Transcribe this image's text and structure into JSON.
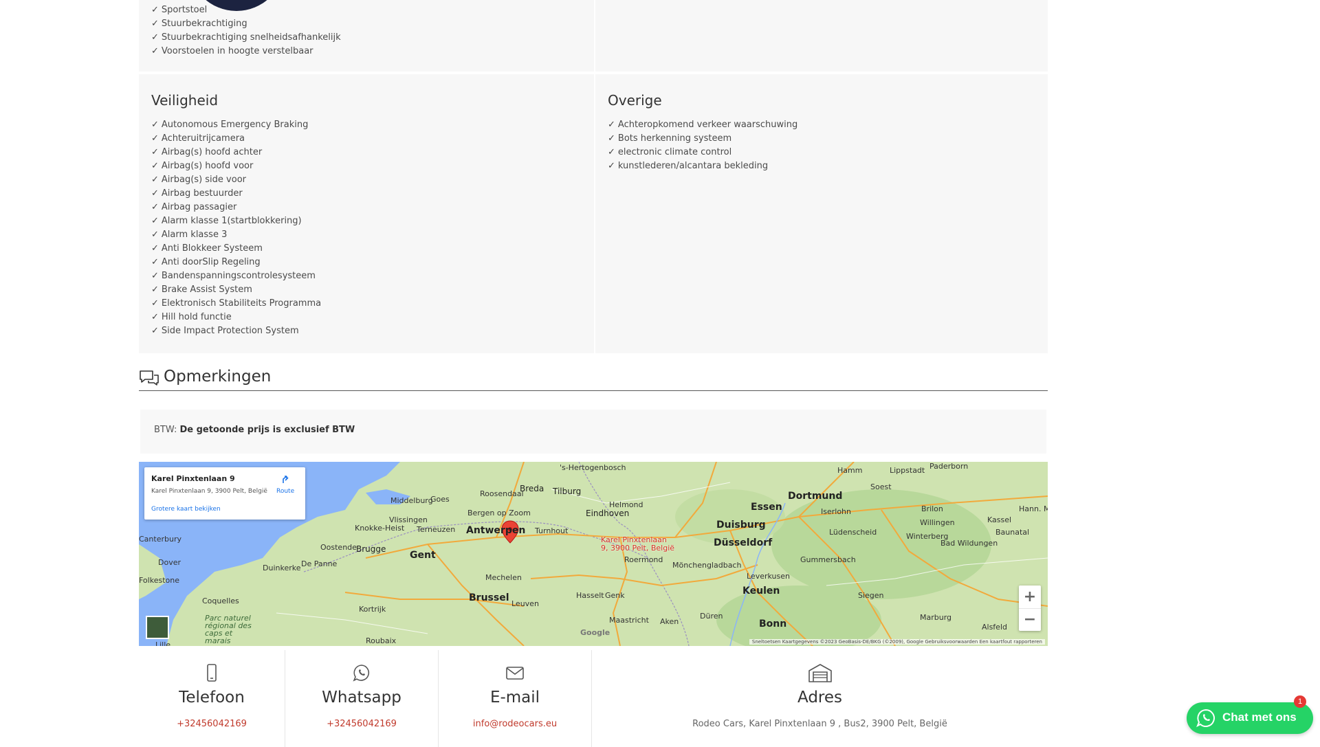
{
  "comfort": {
    "items": [
      "Sportstoel",
      "Stuurbekrachtiging",
      "Stuurbekrachtiging snelheidsafhankelijk",
      "Voorstoelen in hoogte verstelbaar"
    ]
  },
  "check_glyph": "✓",
  "veiligheid": {
    "title": "Veiligheid",
    "items": [
      "Autonomous Emergency Braking",
      "Achteruitrijcamera",
      "Airbag(s) hoofd achter",
      "Airbag(s) hoofd voor",
      "Airbag(s) side voor",
      "Airbag bestuurder",
      "Airbag passagier",
      "Alarm klasse 1(startblokkering)",
      "Alarm klasse 3",
      "Anti Blokkeer Systeem",
      "Anti doorSlip Regeling",
      "Bandenspanningscontrolesysteem",
      "Brake Assist System",
      "Elektronisch Stabiliteits Programma",
      "Hill hold functie",
      "Side Impact Protection System"
    ]
  },
  "overige": {
    "title": "Overige",
    "items": [
      "Achteropkomend verkeer waarschuwing",
      "Bots herkenning systeem",
      "electronic climate control",
      "kunstlederen/alcantara bekleding"
    ]
  },
  "remarks": {
    "heading": "Opmerkingen",
    "btw_label": "BTW:",
    "btw_value": "De getoonde prijs is exclusief BTW"
  },
  "map": {
    "card_title": "Karel Pinxtenlaan 9",
    "card_address": "Karel Pinxtenlaan 9, 3900 Pelt, België",
    "card_link": "Grotere kaart bekijken",
    "route_label": "Route",
    "pin_label_line1": "Karel Pinxtenlaan",
    "pin_label_line2": "9, 3900 Pelt, België",
    "zoom_in": "+",
    "zoom_out": "−",
    "watermark": "Google",
    "footer": "Sneltoetsen   Kaartgegevens ©2023 GeoBasis-DE/BKG (©2009), Google   Gebruiksvoorwaarden   Een kaartfout rapporteren",
    "places_big": [
      "Antwerpen",
      "Brussel",
      "Gent",
      "Essen",
      "Dortmund",
      "Duisburg",
      "Düsseldorf",
      "Keulen",
      "Bonn"
    ],
    "places": [
      "'s-Hertogenbosch",
      "Breda",
      "Tilburg",
      "Eindhoven",
      "Helmond",
      "Roosendaal",
      "Middelburg",
      "Goes",
      "Bergen op Zoom",
      "Vlissingen",
      "Terneuzen",
      "Knokke-Heist",
      "Brugge",
      "Oostende",
      "De Panne",
      "Duinkerke",
      "Turnhout",
      "Mechelen",
      "Leuven",
      "Hasselt",
      "Genk",
      "Maastricht",
      "Aken",
      "Düren",
      "Roermond",
      "Mönchengladbach",
      "Leverkusen",
      "Kortrijk",
      "Roubaix",
      "Dover",
      "Folkestone",
      "Coquelles",
      "Hamm",
      "Lippstadt",
      "Paderborn",
      "Soest",
      "Iserlohn",
      "Lüdenscheid",
      "Brilon",
      "Willingen",
      "Kassel",
      "Baunatal",
      "Winterberg",
      "Bad Wildungen",
      "Gummersbach",
      "Siegen",
      "Marburg",
      "Alsfeld",
      "Hann. Mü",
      "Parc naturel régional des caps et marais",
      "Lille",
      "Canterbury"
    ]
  },
  "contacts": [
    {
      "icon": "phone-icon",
      "title": "Telefoon",
      "value": "+32456042169"
    },
    {
      "icon": "whatsapp-icon",
      "title": "Whatsapp",
      "value": "+32456042169"
    },
    {
      "icon": "mail-icon",
      "title": "E-mail",
      "value": "info@rodeocars.eu"
    },
    {
      "icon": "garage-icon",
      "title": "Adres",
      "value": "Rodeo Cars, Karel Pinxtenlaan 9 , Bus2, 3900 Pelt, België"
    }
  ],
  "whatsapp_chat": {
    "label": "Chat met ons",
    "badge": "1"
  },
  "colors": {
    "panel_bg": "#f7f7f7",
    "link_red": "#c0392b",
    "whatsapp_green": "#25d366",
    "badge_red": "#e53935",
    "map_pin": "#d93025"
  }
}
